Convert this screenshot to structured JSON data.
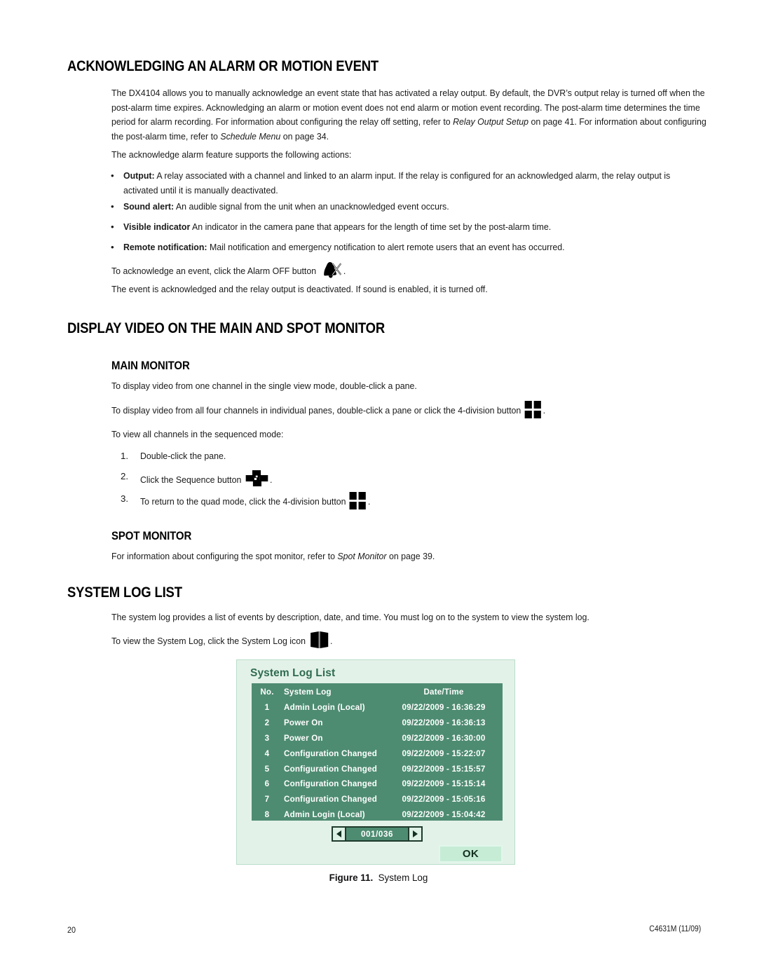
{
  "document": {
    "page_number": "20",
    "doc_code": "C4631M (11/09)"
  },
  "sections": {
    "ack_heading": "ACKNOWLEDGING AN ALARM OR MOTION EVENT",
    "ack_intro_p1_a": "The DX4104 allows you to manually acknowledge an event state that has activated a relay output. By default, the DVR’s output relay is turned off when the post-alarm time expires. Acknowledging an alarm or motion event does not end alarm or motion event recording. The post-alarm time determines the time period for alarm recording. For information about configuring the relay off setting, refer to ",
    "ack_intro_ref1": "Relay Output Setup",
    "ack_intro_p1_b": " on page 41. For information about configuring the post-alarm time, refer to ",
    "ack_intro_ref2": "Schedule Menu",
    "ack_intro_p1_c": " on page 34.",
    "ack_supports_line": "The acknowledge alarm feature supports the following actions:",
    "bullets": [
      {
        "label": "Output:",
        "text": " A relay associated with a channel and linked to an alarm input. If the relay is configured for an acknowledged alarm, the relay output is activated until it is manually deactivated."
      },
      {
        "label": "Sound alert:",
        "text": " An audible signal from the unit when an unacknowledged event occurs."
      },
      {
        "label": "Visible indicator",
        "text": " An indicator in the camera pane that appears for the length of time set by the post-alarm time."
      },
      {
        "label": "Remote notification:",
        "text": " Mail notification and emergency notification to alert remote users that an event has occurred."
      }
    ],
    "ack_click_pre": "To acknowledge an event, click the Alarm OFF button ",
    "ack_click_post": ".",
    "ack_result": "The event is acknowledged and the relay output is deactivated. If sound is enabled, it is turned off.",
    "display_heading": "DISPLAY VIDEO ON THE MAIN AND SPOT MONITOR",
    "main_monitor_heading": "MAIN MONITOR",
    "main_line1": "To display video from one channel in the single view mode, double-click a pane.",
    "main_line2_pre": "To display video from all four channels in individual panes, double-click a pane or click the 4-division button ",
    "main_line2_post": ".",
    "sequenced_intro": "To view all channels in the sequenced mode:",
    "steps": [
      {
        "num": "1.",
        "pre": "Double-click the pane.",
        "post": ""
      },
      {
        "num": "2.",
        "pre": "Click the Sequence button ",
        "post": "."
      },
      {
        "num": "3.",
        "pre": "To return to the quad mode, click the 4-division button ",
        "post": "."
      }
    ],
    "spot_monitor_heading": "SPOT MONITOR",
    "spot_line_a": "For information about configuring the spot monitor, refer to ",
    "spot_ref": "Spot Monitor",
    "spot_line_b": " on page 39.",
    "syslog_heading": "SYSTEM LOG LIST",
    "syslog_line1": "The system log provides a list of events by description, date, and time. You must log on to the system to view the system log.",
    "syslog_line2_pre": "To view the System Log, click the System Log icon ",
    "syslog_line2_post": "."
  },
  "icons": {
    "alarm_off": "bell-slash-icon",
    "four_division": "four-division-grid-icon",
    "sequence": "sequence-pinwheel-icon",
    "system_log": "open-book-icon"
  },
  "dialog": {
    "title": "System Log List",
    "columns": {
      "no": "No.",
      "log": "System Log",
      "date": "Date/Time"
    },
    "rows": [
      {
        "no": "1",
        "log": "Admin Login (Local)",
        "date": "09/22/2009 - 16:36:29"
      },
      {
        "no": "2",
        "log": "Power On",
        "date": "09/22/2009 - 16:36:13"
      },
      {
        "no": "3",
        "log": "Power On",
        "date": "09/22/2009 - 16:30:00"
      },
      {
        "no": "4",
        "log": "Configuration Changed",
        "date": "09/22/2009 - 15:22:07"
      },
      {
        "no": "5",
        "log": "Configuration Changed",
        "date": "09/22/2009 - 15:15:57"
      },
      {
        "no": "6",
        "log": "Configuration Changed",
        "date": "09/22/2009 - 15:15:14"
      },
      {
        "no": "7",
        "log": "Configuration Changed",
        "date": "09/22/2009 - 15:05:16"
      },
      {
        "no": "8",
        "log": "Admin Login (Local)",
        "date": "09/22/2009 - 15:04:42"
      }
    ],
    "pager": {
      "prev": "◀",
      "value": "001/036",
      "next": "▶"
    },
    "ok_label": "OK",
    "colors": {
      "panel_bg": "#e3f2e9",
      "table_bg": "#4e8c72",
      "title_text": "#2f6b4f",
      "button_bg": "#c6ecd6",
      "row_text": "#ffffff"
    }
  },
  "figure": {
    "label": "Figure 11.",
    "caption": "System Log"
  }
}
